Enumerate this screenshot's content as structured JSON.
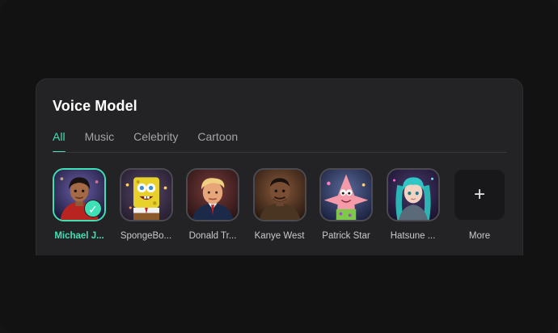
{
  "panel": {
    "title": "Voice Model",
    "tabs": [
      {
        "label": "All",
        "active": true
      },
      {
        "label": "Music",
        "active": false
      },
      {
        "label": "Celebrity",
        "active": false
      },
      {
        "label": "Cartoon",
        "active": false
      }
    ]
  },
  "models": [
    {
      "label": "Michael J...",
      "selected": true
    },
    {
      "label": "SpongeBo...",
      "selected": false
    },
    {
      "label": "Donald Tr...",
      "selected": false
    },
    {
      "label": "Kanye West",
      "selected": false
    },
    {
      "label": "Patrick Star",
      "selected": false
    },
    {
      "label": "Hatsune ...",
      "selected": false
    }
  ],
  "more": {
    "label": "More",
    "icon": "plus-icon",
    "glyph": "+"
  },
  "check_glyph": "✓",
  "colors": {
    "accent": "#3fe0b5",
    "panel_bg": "#232325",
    "page_bg": "#121212"
  }
}
